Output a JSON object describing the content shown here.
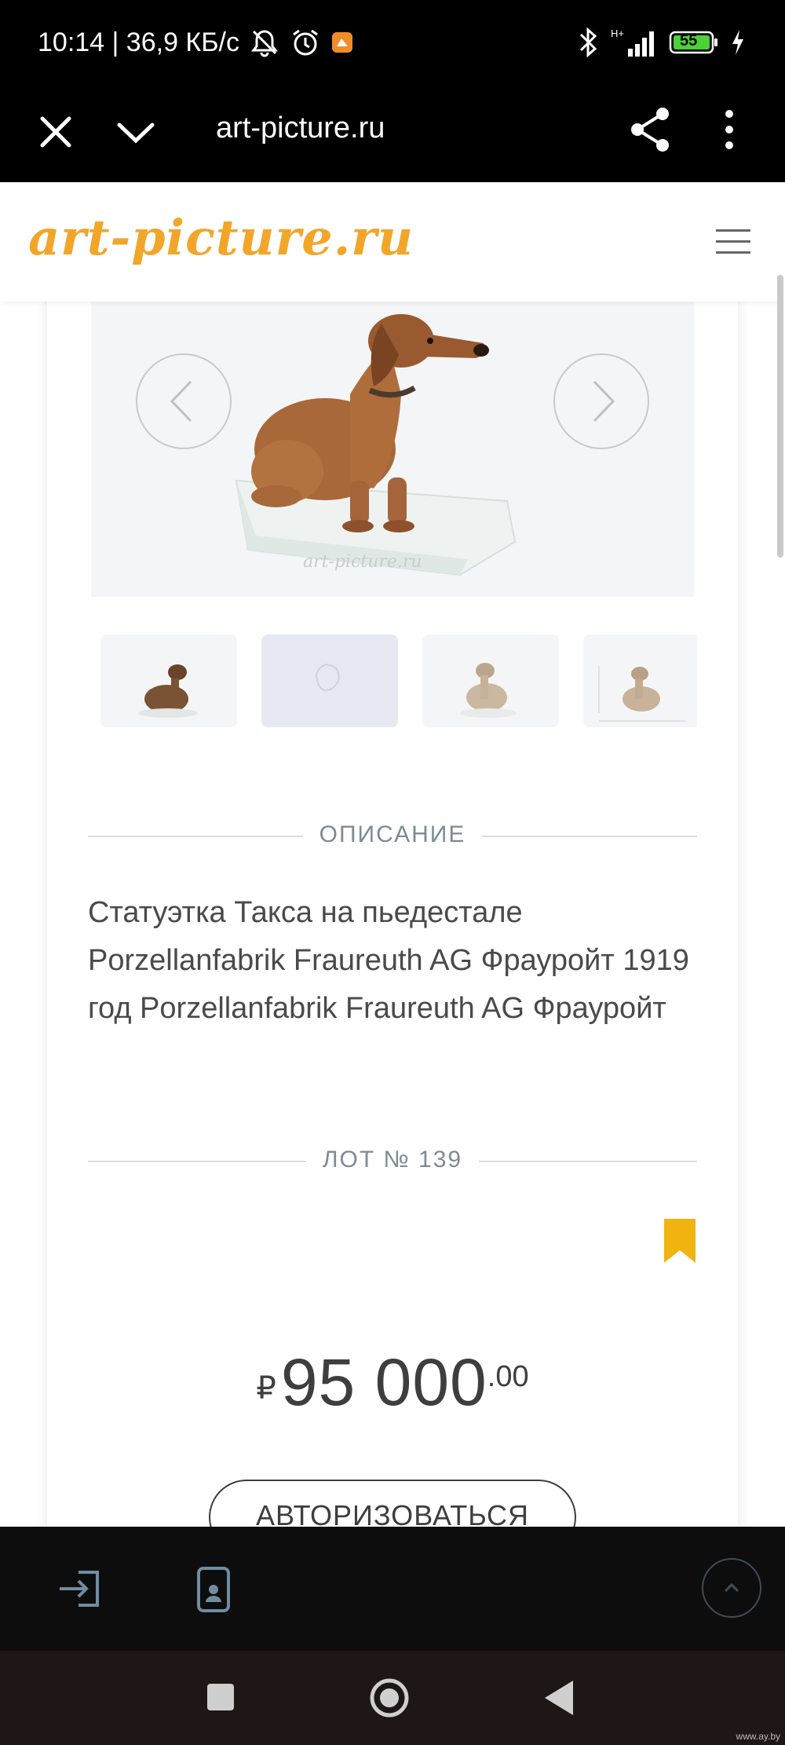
{
  "status_bar": {
    "time_speed": "10:14 | 36,9 КБ/с",
    "network": "H+",
    "battery": "55"
  },
  "browser": {
    "url": "art-picture.ru"
  },
  "site": {
    "logo_text": "art-picture.ru"
  },
  "product": {
    "photo_watermark": "art-picture.ru",
    "description_heading": "ОПИСАНИЕ",
    "description": "Статуэтка Такса на пьедестале Porzellanfabrik Fraureuth AG Фрауройт 1919 год Porzellanfabrik Fraureuth AG Фрауройт",
    "lot_heading": "ЛОТ № 139",
    "price_currency": "₽",
    "price_main": "95 000",
    "price_cents": ".00",
    "auth_button": "АВТОРИЗОВАТЬСЯ"
  },
  "colors": {
    "brand": "#f2a629",
    "bookmark": "#f1b310",
    "battery_fill": "#4cd137"
  },
  "icons": [
    "silent-icon",
    "alarm-icon",
    "notification-app-icon",
    "bluetooth-icon",
    "signal-icon",
    "battery-icon",
    "charging-icon",
    "close-icon",
    "chevron-down-icon",
    "share-icon",
    "more-icon",
    "menu-icon",
    "arrow-left-icon",
    "arrow-right-icon",
    "bookmark-icon",
    "login-icon",
    "phone-icon",
    "scroll-up-icon"
  ],
  "watermark": "www.ay.by"
}
